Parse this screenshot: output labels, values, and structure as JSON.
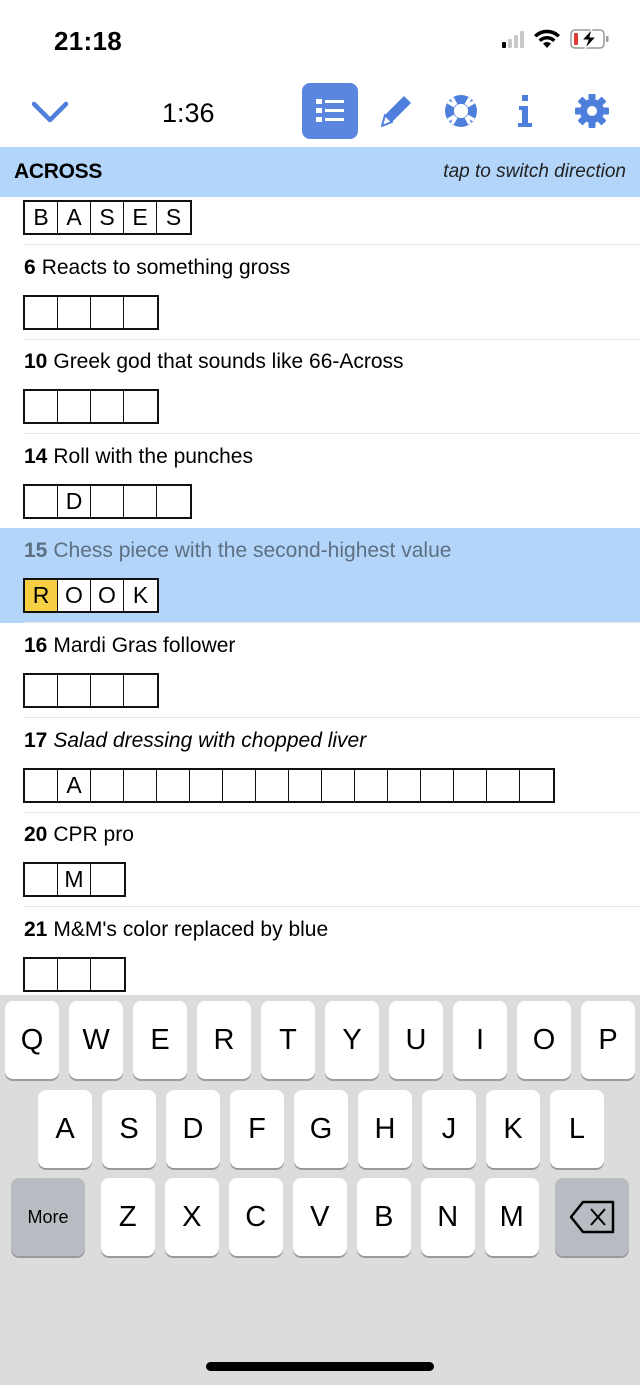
{
  "status_bar": {
    "time": "21:18",
    "signal_bars_on": 1,
    "signal_bars_total": 4,
    "icons": [
      "cellular-signal-icon",
      "wifi-icon",
      "battery-charging-low-icon"
    ],
    "battery_color": "#e53935"
  },
  "toolbar": {
    "timer": "1:36",
    "buttons": [
      {
        "name": "collapse-chevron",
        "icon": "chevron-down-icon"
      },
      {
        "name": "clue-list",
        "icon": "list-icon",
        "active": true
      },
      {
        "name": "pencil-mode",
        "icon": "pencil-icon"
      },
      {
        "name": "help",
        "icon": "lifebuoy-icon"
      },
      {
        "name": "info",
        "icon": "info-icon"
      },
      {
        "name": "settings",
        "icon": "gear-icon"
      }
    ],
    "accent": "#5b86e0"
  },
  "direction_header": {
    "direction": "ACROSS",
    "hint": "tap to switch direction",
    "background": "#b3d5fa"
  },
  "clues": [
    {
      "number": "",
      "text": "",
      "cells": [
        "B",
        "A",
        "S",
        "E",
        "S"
      ],
      "partial": true
    },
    {
      "number": "6",
      "text": "Reacts to something gross",
      "cells": [
        "",
        "",
        "",
        ""
      ]
    },
    {
      "number": "10",
      "text": "Greek god that sounds like 66-Across",
      "cells": [
        "",
        "",
        "",
        ""
      ]
    },
    {
      "number": "14",
      "text": "Roll with the punches",
      "cells": [
        "",
        "D",
        "",
        "",
        ""
      ]
    },
    {
      "number": "15",
      "text": "Chess piece with the second-highest value",
      "cells": [
        "R",
        "O",
        "O",
        "K"
      ],
      "active": true,
      "cursor_index": 0
    },
    {
      "number": "16",
      "text": "Mardi Gras follower",
      "cells": [
        "",
        "",
        "",
        ""
      ]
    },
    {
      "number": "17",
      "text": "Salad dressing with chopped liver",
      "italic": true,
      "cells": [
        "",
        "A",
        "",
        "",
        "",
        "",
        "",
        "",
        "",
        "",
        "",
        "",
        "",
        "",
        "",
        ""
      ]
    },
    {
      "number": "20",
      "text": "CPR pro",
      "cells": [
        "",
        "M",
        ""
      ]
    },
    {
      "number": "21",
      "text": "M&M's color replaced by blue",
      "cells": [
        "",
        "",
        ""
      ]
    }
  ],
  "highlight_color": "#f6cf44",
  "keyboard": {
    "row1": [
      "Q",
      "W",
      "E",
      "R",
      "T",
      "Y",
      "U",
      "I",
      "O",
      "P"
    ],
    "row2": [
      "A",
      "S",
      "D",
      "F",
      "G",
      "H",
      "J",
      "K",
      "L"
    ],
    "row3": [
      "Z",
      "X",
      "C",
      "V",
      "B",
      "N",
      "M"
    ],
    "more_label": "More",
    "backspace_icon": "backspace-icon"
  }
}
